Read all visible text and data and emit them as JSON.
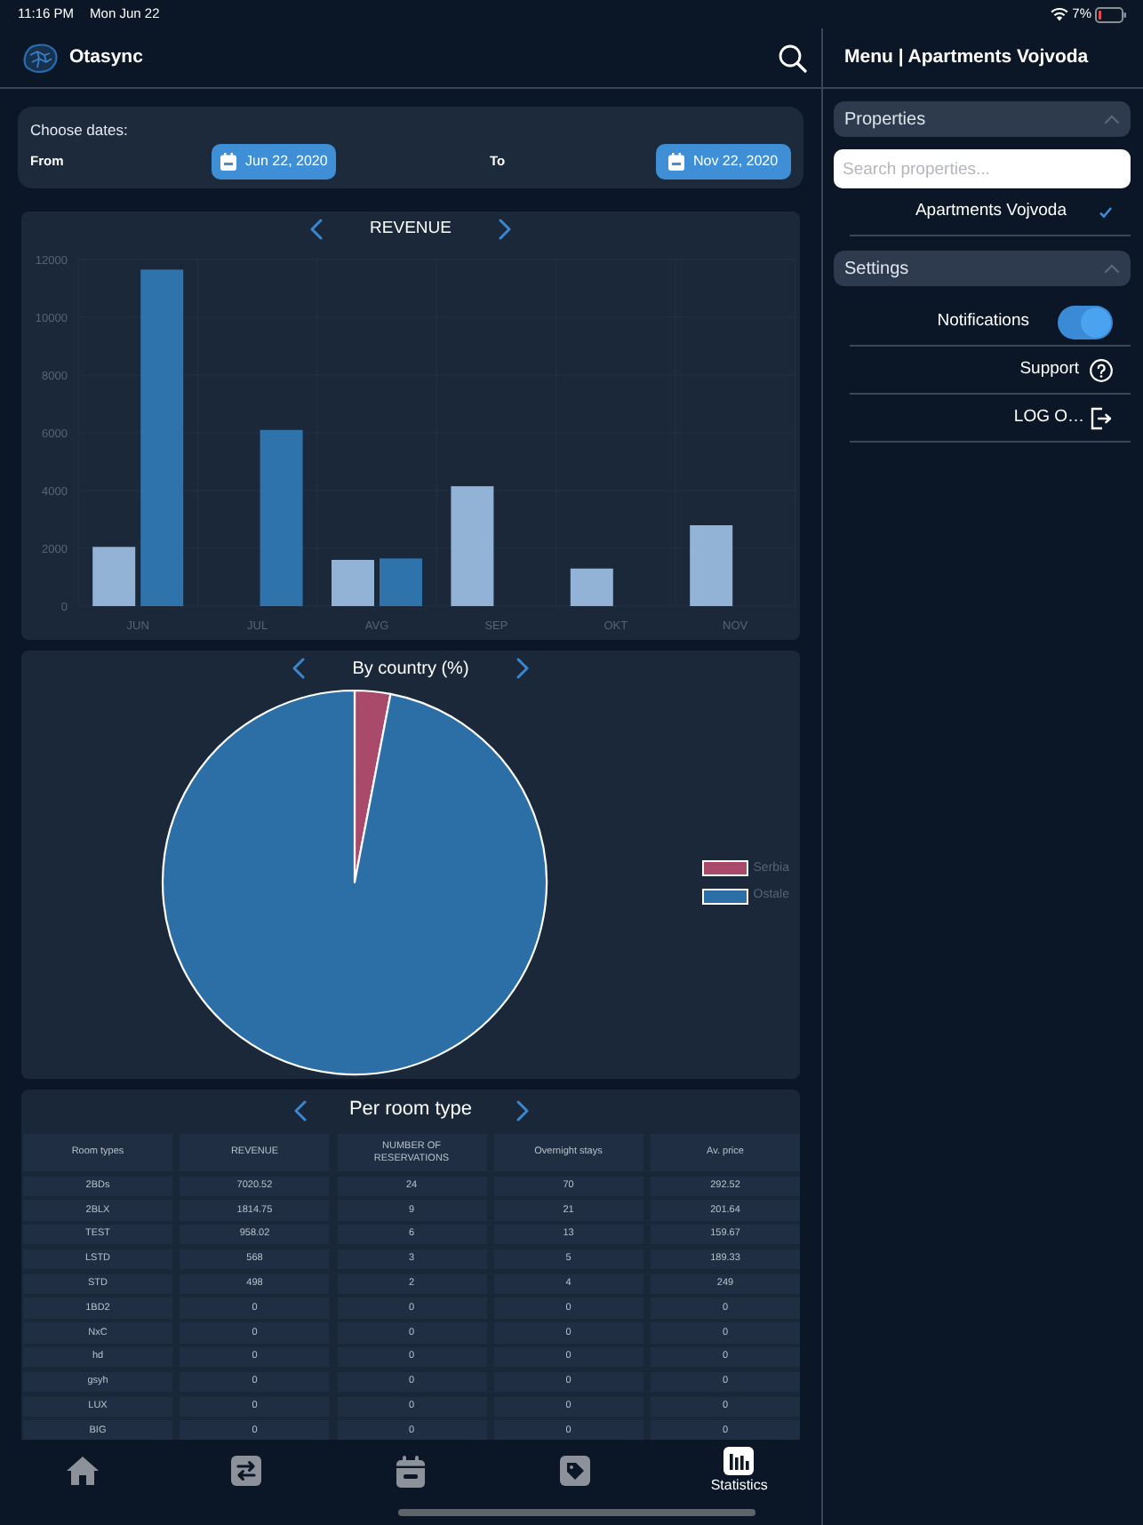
{
  "status_bar": {
    "time": "11:16 PM",
    "date": "Mon Jun 22",
    "battery": "7%"
  },
  "header": {
    "app_name": "Otasync"
  },
  "date_range": {
    "title": "Choose dates:",
    "from": {
      "label": "From",
      "value": "Jun 22, 2020"
    },
    "to": {
      "label": "To",
      "value": "Nov 22, 2020"
    }
  },
  "revenue_chart": {
    "chart_data": {
      "type": "bar",
      "title": "REVENUE",
      "categories": [
        "JUN",
        "JUL",
        "AVG",
        "SEP",
        "OKT",
        "NOV"
      ],
      "series": [
        {
          "color": "#93b3d6",
          "values": [
            2050,
            0,
            1600,
            4150,
            1300,
            2800
          ]
        },
        {
          "color": "#2e73ab",
          "values": [
            11650,
            6100,
            1650,
            0,
            0,
            0
          ]
        }
      ],
      "ylim": [
        0,
        12000
      ],
      "yticks": [
        0,
        2000,
        4000,
        6000,
        8000,
        10000,
        12000
      ]
    }
  },
  "country_chart": {
    "title": "By country (%)",
    "legend": [
      {
        "label": "Serbia",
        "color": "#a94a6a"
      },
      {
        "label": "Ostale",
        "color": "#2c6fa7"
      }
    ]
  },
  "room_type_table": {
    "title": "Per room type",
    "columns": [
      "Room types",
      "REVENUE",
      "NUMBER OF RESERVATIONS",
      "Overnight stays",
      "Av. price"
    ],
    "rows": [
      [
        "2BDs",
        "7020.52",
        "24",
        "70",
        "292.52"
      ],
      [
        "2BLX",
        "1814.75",
        "9",
        "21",
        "201.64"
      ],
      [
        "TEST",
        "958.02",
        "6",
        "13",
        "159.67"
      ],
      [
        "LSTD",
        "568",
        "3",
        "5",
        "189.33"
      ],
      [
        "STD",
        "498",
        "2",
        "4",
        "249"
      ],
      [
        "1BD2",
        "0",
        "0",
        "0",
        "0"
      ],
      [
        "NxC",
        "0",
        "0",
        "0",
        "0"
      ],
      [
        "hd",
        "0",
        "0",
        "0",
        "0"
      ],
      [
        "gsyh",
        "0",
        "0",
        "0",
        "0"
      ],
      [
        "LUX",
        "0",
        "0",
        "0",
        "0"
      ],
      [
        "BIG",
        "0",
        "0",
        "0",
        "0"
      ]
    ]
  },
  "tab_bar": {
    "tabs": [
      {
        "selected": false
      },
      {
        "selected": false
      },
      {
        "selected": false
      },
      {
        "selected": false
      },
      {
        "label": "Statistics",
        "selected": true
      }
    ]
  },
  "menu_panel": {
    "title": "Menu | Apartments Vojvoda",
    "properties": {
      "title": "Properties",
      "expanded": true,
      "search": {
        "placeholder": "Search properties..."
      },
      "items": [
        {
          "label": "Apartments Vojvoda",
          "selected": true
        }
      ]
    },
    "settings": {
      "title": "Settings",
      "expanded": true,
      "items": [
        {
          "kind": "toggle",
          "label": "Notifications",
          "on": true
        },
        {
          "kind": "support",
          "label": "Support"
        },
        {
          "kind": "logout",
          "label": "LOG O…"
        }
      ]
    }
  }
}
